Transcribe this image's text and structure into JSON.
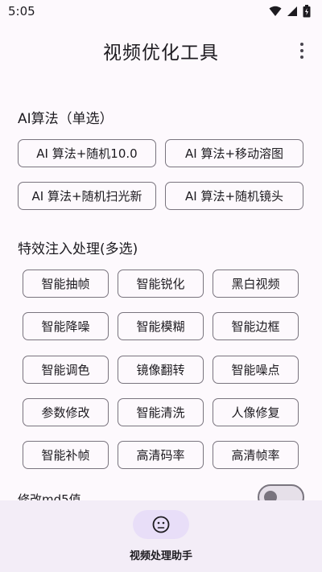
{
  "status_bar": {
    "time": "5:05"
  },
  "app_bar": {
    "title": "视频优化工具",
    "more_icon": "more-vert-icon"
  },
  "ai_section": {
    "title": "AI算法（单选）",
    "options": [
      "AI 算法+随机10.0",
      "AI 算法+移动溶图",
      "AI 算法+随机扫光新",
      "AI 算法+随机镜头"
    ]
  },
  "effects_section": {
    "title": "特效注入处理(多选)",
    "options": [
      "智能抽帧",
      "智能锐化",
      "黑白视频",
      "智能降噪",
      "智能模糊",
      "智能边框",
      "智能调色",
      "镜像翻转",
      "智能噪点",
      "参数修改",
      "智能清洗",
      "人像修复",
      "智能补帧",
      "高清码率",
      "高清帧率"
    ]
  },
  "md5_toggle": {
    "label": "修改md5值",
    "checked": false
  },
  "bottom_nav": {
    "label": "视频处理助手",
    "icon": "face-icon"
  },
  "colors": {
    "background": "#fdf9fd",
    "chip_border": "#79747e",
    "nav_background": "#f3edf7",
    "nav_indicator": "#e8def8"
  }
}
